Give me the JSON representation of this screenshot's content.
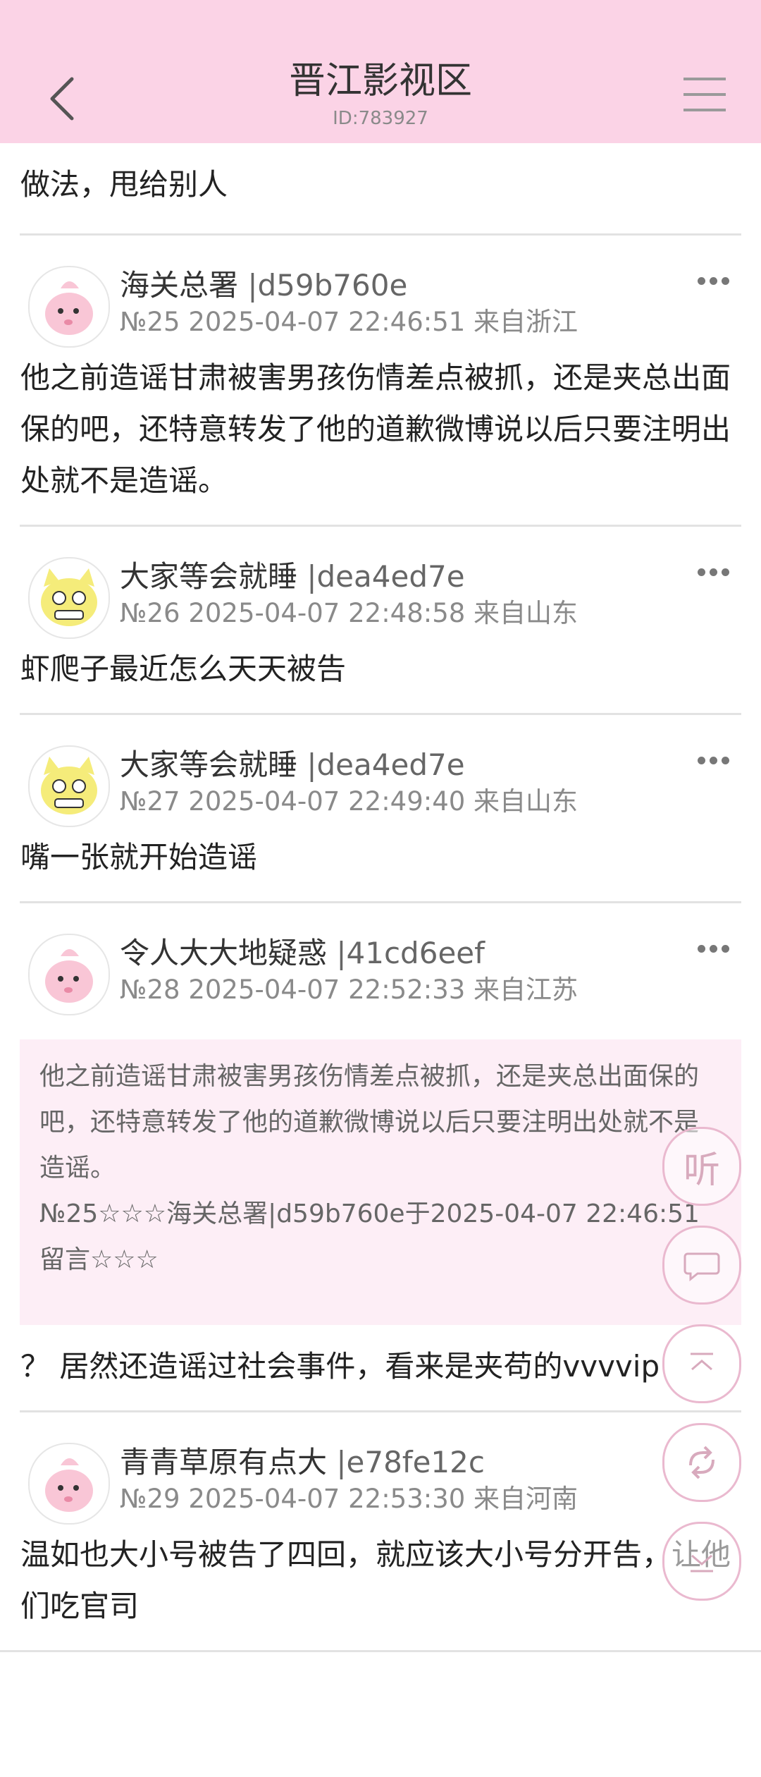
{
  "header": {
    "title": "晋江影视区",
    "subtitle": "ID:783927"
  },
  "fragment": {
    "text": "做法，甩给别人"
  },
  "posts": [
    {
      "username": "海关总署",
      "userid": "|d59b760e",
      "meta": "№25 2025-04-07 22:46:51 来自浙江",
      "avatar": "pink-creature-avatar",
      "text": "他之前造谣甘肃被害男孩伤情差点被抓，还是夹总出面保的吧，还特意转发了他的道歉微博说以后只要注明出处就不是造谣。"
    },
    {
      "username": "大家等会就睡",
      "userid": "|dea4ed7e",
      "meta": "№26 2025-04-07 22:48:58 来自山东",
      "avatar": "yellow-cat-avatar",
      "text": "虾爬子最近怎么天天被告"
    },
    {
      "username": "大家等会就睡",
      "userid": "|dea4ed7e",
      "meta": "№27 2025-04-07 22:49:40 来自山东",
      "avatar": "yellow-cat-avatar",
      "text": "嘴一张就开始造谣"
    },
    {
      "username": "令人大大地疑惑",
      "userid": "|41cd6eef",
      "meta": "№28 2025-04-07 22:52:33 来自江苏",
      "avatar": "pink-creature-avatar",
      "quote": "他之前造谣甘肃被害男孩伤情差点被抓，还是夹总出面保的吧，还特意转发了他的道歉微博说以后只要注明出处就不是造谣。\n№25☆☆☆海关总署|d59b760e于2025-04-07 22:46:51留言☆☆☆",
      "text": "？ 居然还造谣过社会事件，看来是夹苟的vvvvip"
    },
    {
      "username": "青青草原有点大",
      "userid": "|e78fe12c",
      "meta": "№29 2025-04-07 22:53:30 来自河南",
      "avatar": "pink-creature-avatar",
      "text": "温如也大小号被告了四回，就应该大小号分开告，让他们吃官司"
    }
  ],
  "float_buttons": {
    "listen": "听",
    "comment": "comment-icon",
    "top": "scroll-top-icon",
    "refresh": "refresh-icon",
    "bottom": "scroll-bottom-icon"
  },
  "colors": {
    "header_bg": "#fbd3e6",
    "quote_bg": "#fdeef6",
    "button_border": "#eab9cf"
  }
}
